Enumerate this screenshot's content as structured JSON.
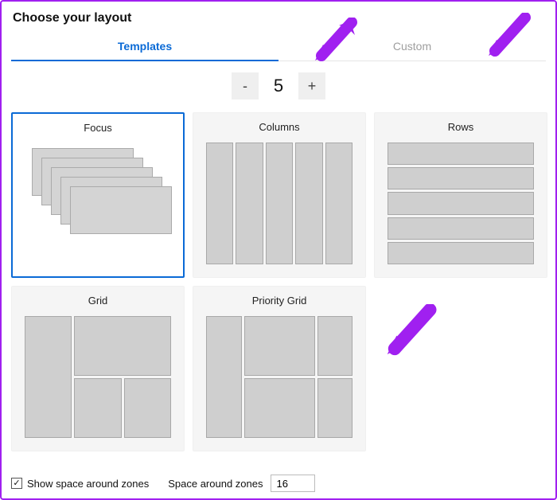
{
  "title": "Choose your layout",
  "tabs": {
    "templates": "Templates",
    "custom": "Custom",
    "active": "templates"
  },
  "stepper": {
    "decrement": "-",
    "increment": "+",
    "value": "5"
  },
  "templates": {
    "focus": "Focus",
    "columns": "Columns",
    "rows": "Rows",
    "grid": "Grid",
    "priority_grid": "Priority Grid",
    "selected": "focus"
  },
  "footer": {
    "show_space_label": "Show space around zones",
    "show_space_checked": true,
    "space_label": "Space around zones",
    "space_value": "16"
  },
  "accent_color": "#a020f0"
}
